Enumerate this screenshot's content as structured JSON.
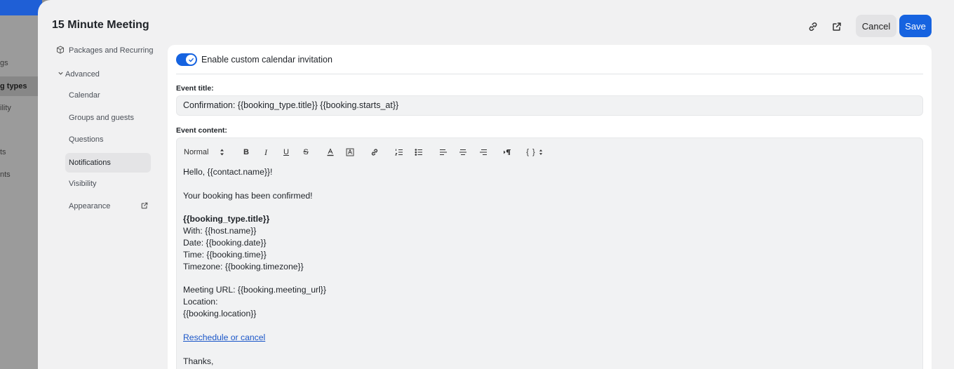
{
  "background": {
    "sidebar_items": [
      "gs",
      "g types",
      "ility",
      "ts",
      "nts"
    ]
  },
  "header": {
    "title": "15 Minute Meeting",
    "copy_link_icon": "link-icon",
    "open_external_icon": "external-link-icon",
    "cancel_label": "Cancel",
    "save_label": "Save"
  },
  "nav": {
    "packages": "Packages and Recurring",
    "advanced": "Advanced",
    "items": [
      "Calendar",
      "Groups and guests",
      "Questions",
      "Notifications",
      "Visibility",
      "Appearance"
    ],
    "selected": "Notifications"
  },
  "content": {
    "toggle_label": "Enable custom calendar invitation",
    "toggle_on": true,
    "event_title_label": "Event title:",
    "event_title_value": "Confirmation: {{booking_type.title}} {{booking.starts_at}}",
    "event_content_label": "Event content:",
    "toolbar": {
      "style_select": "Normal",
      "bold": "B",
      "italic": "I",
      "underline": "U",
      "strike": "S",
      "variables": "{ }"
    },
    "body_lines": [
      "Hello, {{contact.name}}!",
      "",
      "Your booking has been confirmed!",
      "",
      "{{booking_type.title}}",
      "With: {{host.name}}",
      "Date: {{booking.date}}",
      "Time: {{booking.time}}",
      "Timezone: {{booking.timezone}}",
      "",
      "Meeting URL: {{booking.meeting_url}}",
      "Location:",
      "{{booking.location}}",
      "",
      "Reschedule or cancel",
      "",
      "Thanks,"
    ]
  },
  "colors": {
    "accent": "#1663e0",
    "link": "#1a56c8"
  }
}
